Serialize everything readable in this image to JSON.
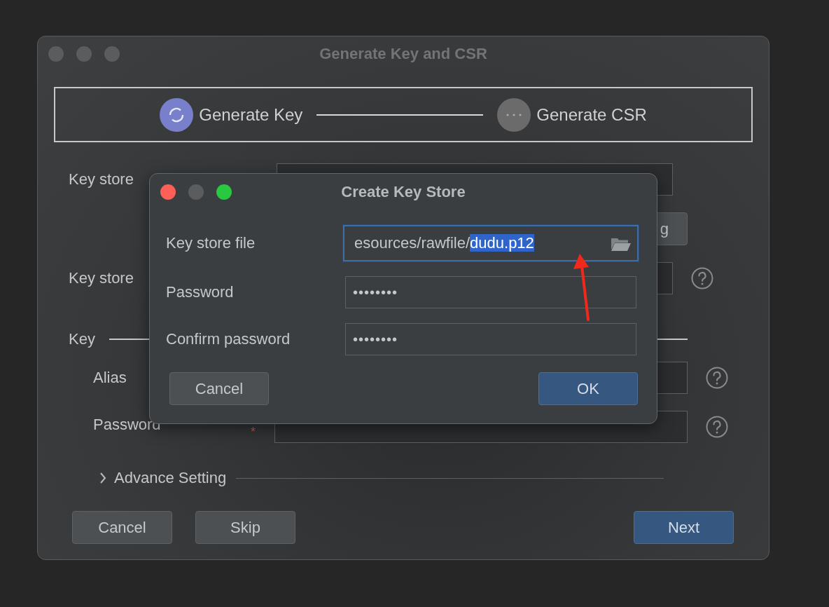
{
  "main_window": {
    "title": "Generate Key and CSR",
    "steps": [
      {
        "label": "Generate Key",
        "active": true
      },
      {
        "label": "Generate CSR",
        "active": false
      }
    ],
    "key_store_label_1": "Key store",
    "partial_button": "g",
    "key_store_label_2": "Key store",
    "key_section": "Key",
    "alias_label": "Alias",
    "password_label": "Password",
    "password_required": "*",
    "advance_setting": {
      "label": "Advance Setting",
      "expanded": false
    },
    "buttons": [
      {
        "label": "Cancel",
        "primary": false
      },
      {
        "label": "Skip",
        "primary": false
      },
      {
        "label": "Next",
        "primary": true
      }
    ]
  },
  "dialog": {
    "title": "Create Key Store",
    "fields": [
      {
        "label": "Key store file",
        "kind": "file",
        "focused": true,
        "value_parts": [
          {
            "text": "esources/rawfile/",
            "selected": false
          },
          {
            "text": "dudu.p12",
            "selected": true
          }
        ]
      },
      {
        "label": "Password",
        "kind": "password",
        "focused": false,
        "value": "••••••••"
      },
      {
        "label": "Confirm password",
        "kind": "password",
        "focused": false,
        "value": "••••••••"
      }
    ],
    "buttons": [
      {
        "label": "Cancel",
        "primary": false
      },
      {
        "label": "OK",
        "primary": true
      }
    ]
  }
}
